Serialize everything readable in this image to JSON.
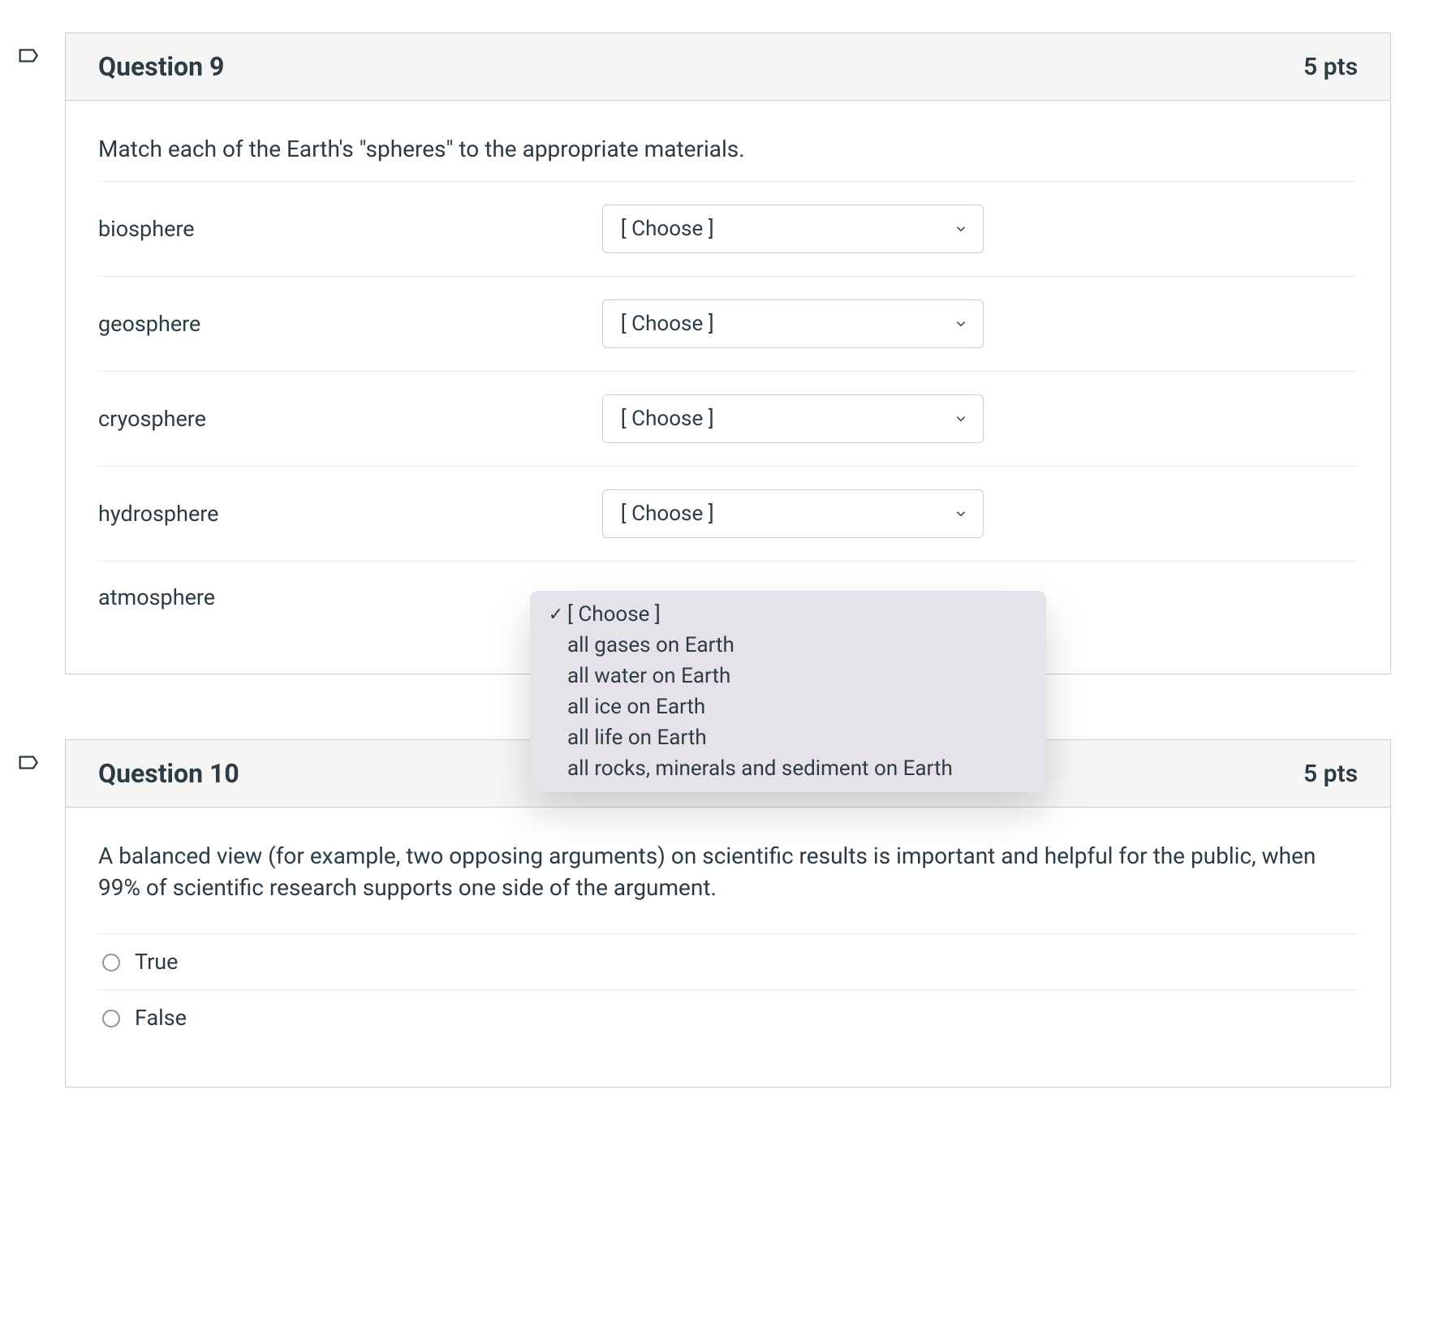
{
  "questions": [
    {
      "title": "Question 9",
      "points": "5 pts",
      "prompt": "Match each of the Earth's \"spheres\" to the appropriate materials.",
      "matches": [
        {
          "label": "biosphere",
          "selected": "[ Choose ]"
        },
        {
          "label": "geosphere",
          "selected": "[ Choose ]"
        },
        {
          "label": "cryosphere",
          "selected": "[ Choose ]"
        },
        {
          "label": "hydrosphere",
          "selected": "[ Choose ]"
        },
        {
          "label": "atmosphere",
          "selected": "[ Choose ]"
        }
      ]
    },
    {
      "title": "Question 10",
      "points": "5 pts",
      "prompt": "A balanced view (for example, two opposing arguments) on scientific results is important and helpful for the public, when 99% of scientific research supports one side of the argument.",
      "options": [
        {
          "label": "True"
        },
        {
          "label": "False"
        }
      ]
    }
  ],
  "dropdown": {
    "check": "✓",
    "items": [
      "[ Choose ]",
      "all gases on Earth",
      "all water on Earth",
      "all ice on Earth",
      "all life on Earth",
      "all rocks, minerals and sediment on Earth"
    ],
    "selected_index": 0
  }
}
